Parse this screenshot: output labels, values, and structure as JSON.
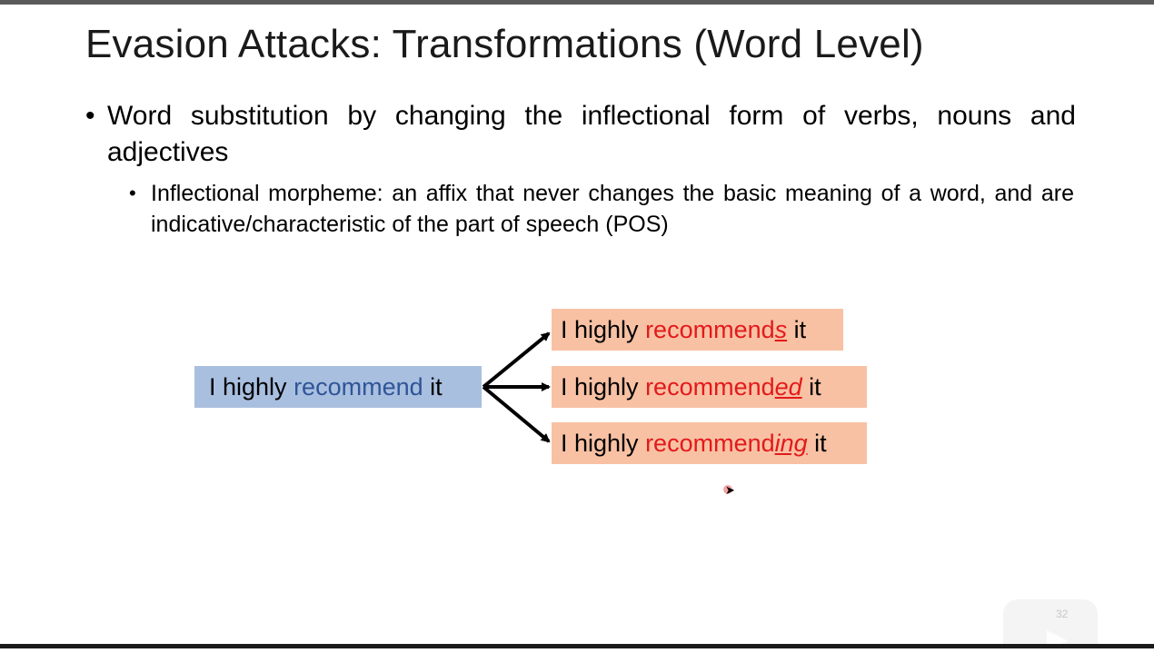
{
  "slide": {
    "title": "Evasion Attacks: Transformations (Word Level)",
    "bullet1": {
      "marker": "•",
      "text": "Word substitution by changing the inflectional form of verbs, nouns and adjectives"
    },
    "bullet2": {
      "marker": "•",
      "text": "Inflectional morpheme: an affix that never changes the basic meaning of a word, and are indicative/characteristic of the part of speech (POS)"
    },
    "page_number": "32"
  },
  "diagram": {
    "source": {
      "prefix": "I highly ",
      "highlight": "recommend",
      "suffix": " it"
    },
    "targets": [
      {
        "prefix": "I highly ",
        "stem": "recommend",
        "affix": "s",
        "suffix": " it"
      },
      {
        "prefix": "I highly ",
        "stem": "recommend",
        "affix": "ed",
        "suffix": " it"
      },
      {
        "prefix": "I highly ",
        "stem": "recommend",
        "affix": "ing",
        "suffix": " it"
      }
    ]
  },
  "colors": {
    "source_box": "#a9bfe0",
    "source_highlight": "#2f5597",
    "target_box": "#f8c1a4",
    "target_red": "#e31a1a"
  },
  "icons": {
    "cursor": "mouse-pointer-icon",
    "player": "video-player-overlay-icon"
  }
}
